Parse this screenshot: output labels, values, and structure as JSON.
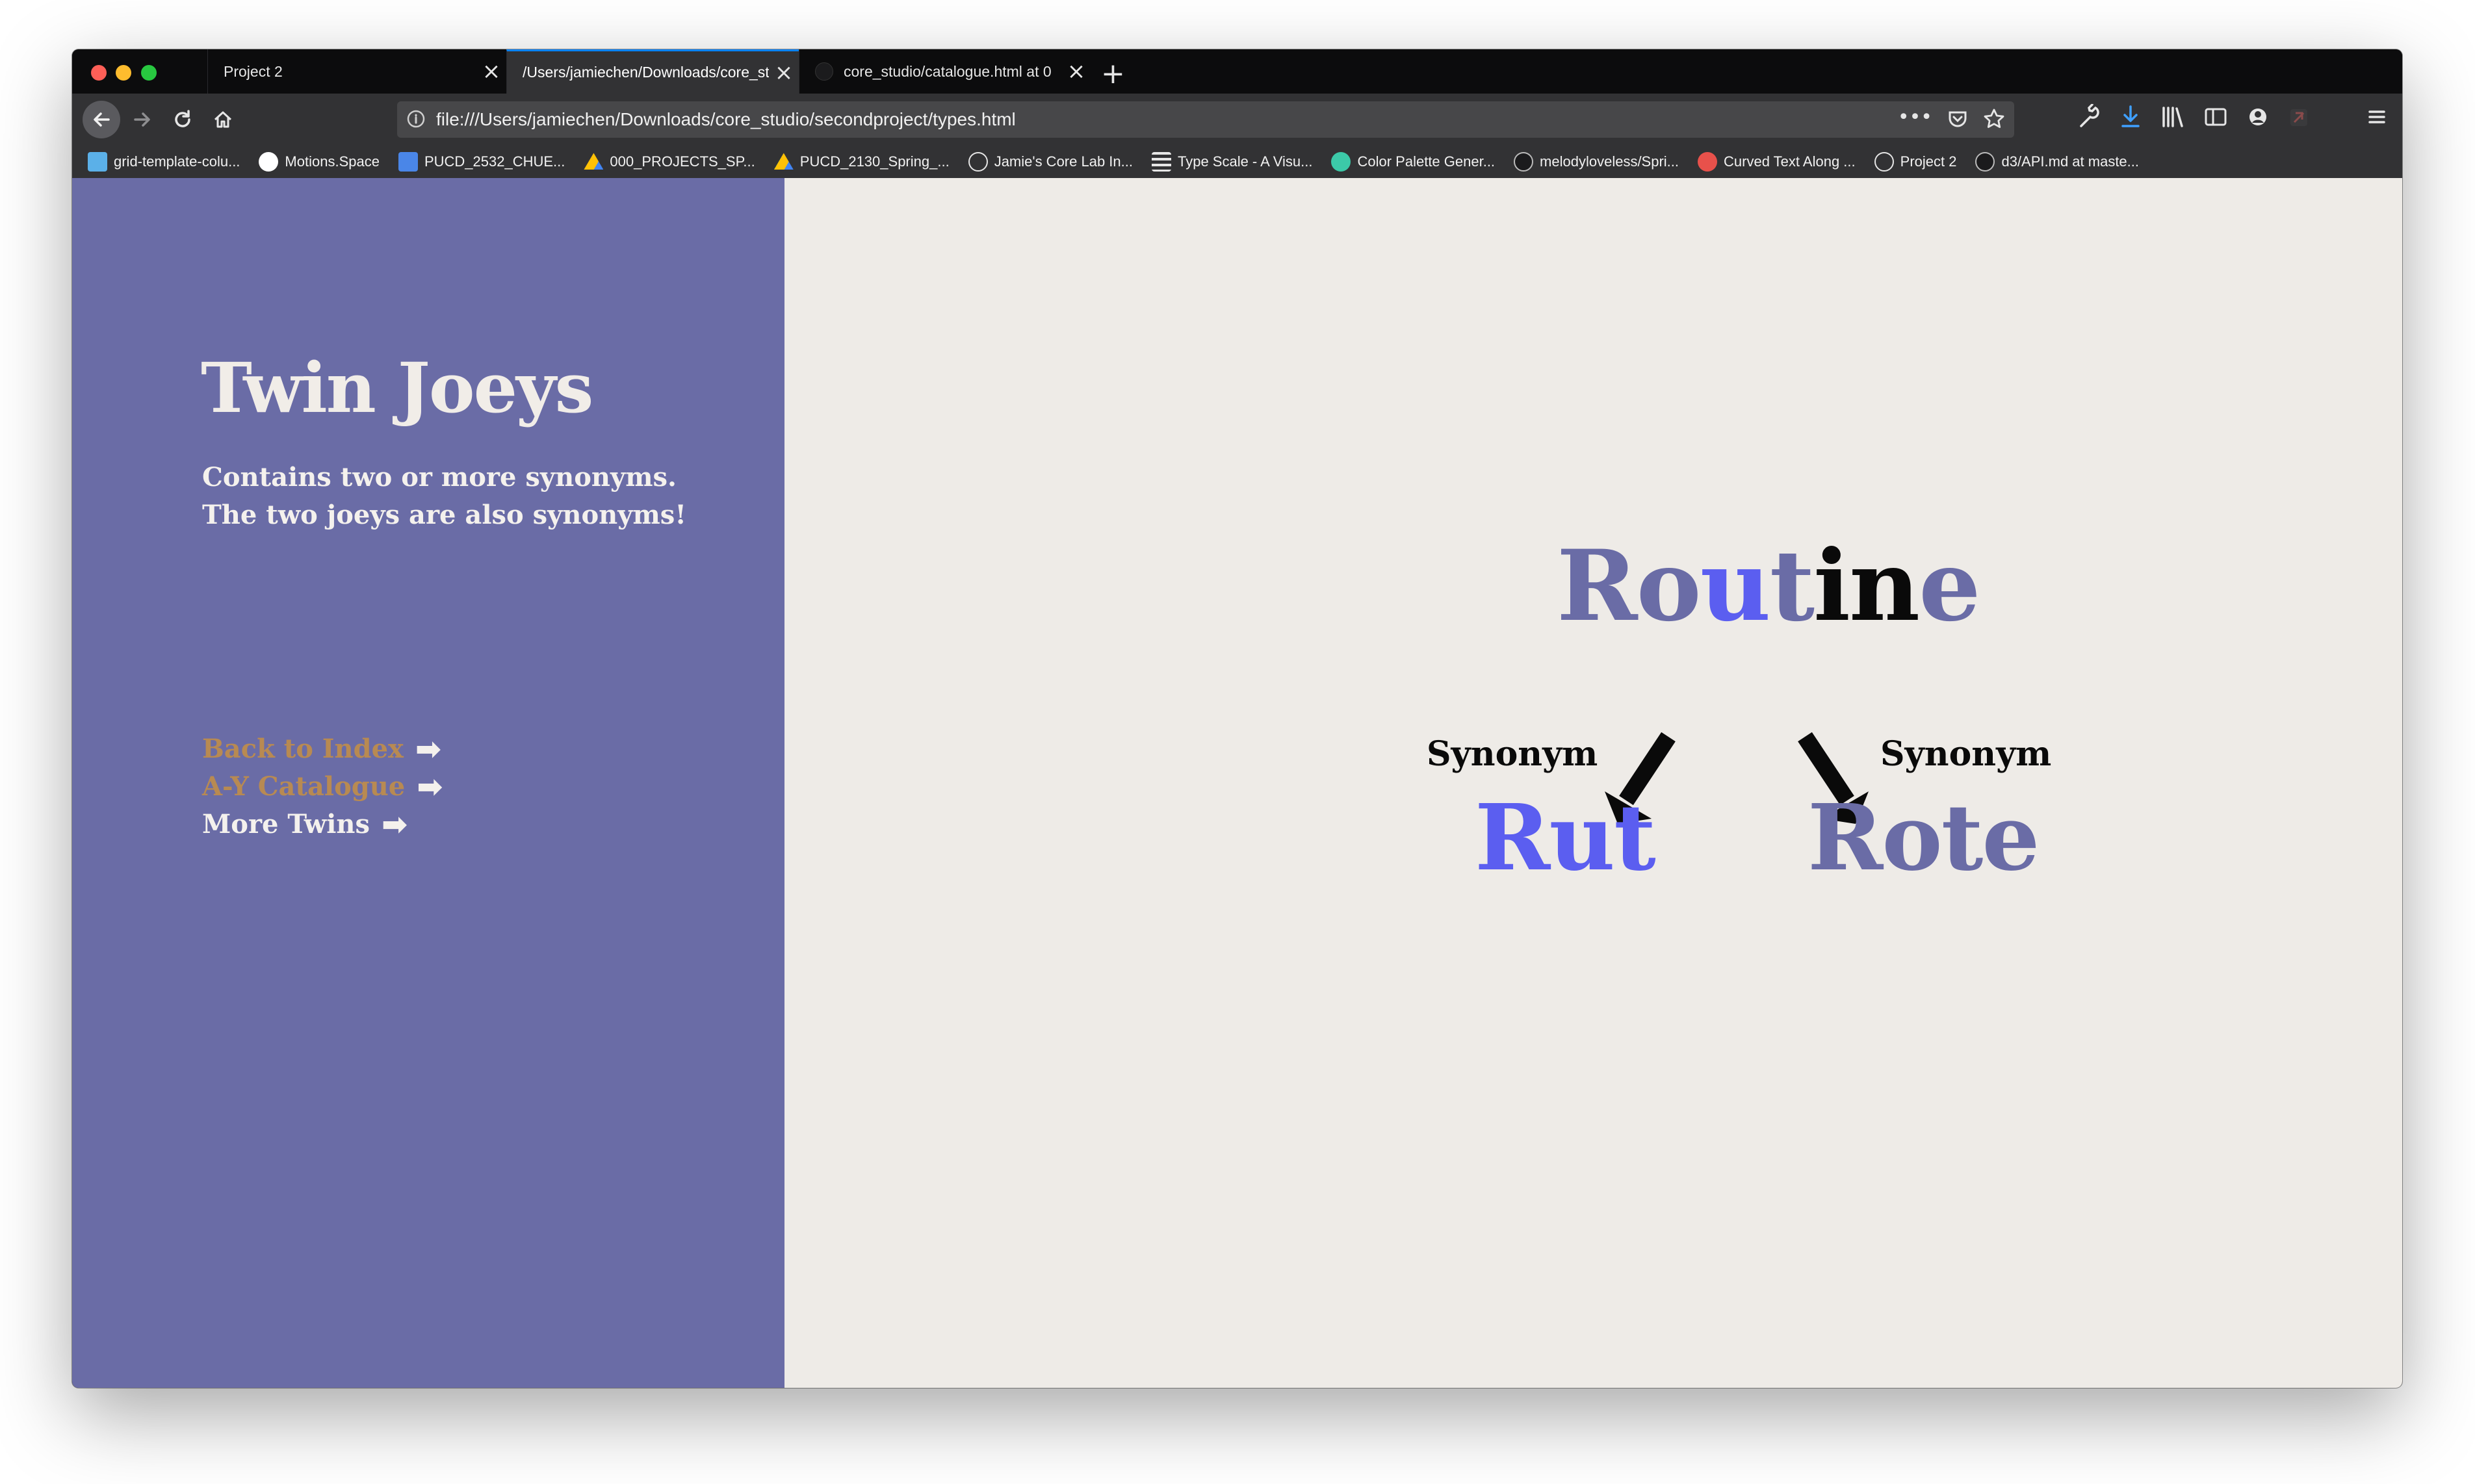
{
  "browser": {
    "tabs": [
      {
        "label": "Project 2",
        "active": false
      },
      {
        "label": "/Users/jamiechen/Downloads/core_studio/secondproject/types.html",
        "active": true
      },
      {
        "label": "core_studio/catalogue.html at 0",
        "active": false
      }
    ],
    "url": "file:///Users/jamiechen/Downloads/core_studio/secondproject/types.html",
    "bookmarks": [
      {
        "label": "grid-template-colu...",
        "icon": "grid-favicon"
      },
      {
        "label": "Motions.Space",
        "icon": "circle-favicon"
      },
      {
        "label": "PUCD_2532_CHUE...",
        "icon": "docs-favicon"
      },
      {
        "label": "000_PROJECTS_SP...",
        "icon": "drive-favicon"
      },
      {
        "label": "PUCD_2130_Spring_...",
        "icon": "drive-favicon"
      },
      {
        "label": "Jamie's Core Lab In...",
        "icon": "globe-favicon"
      },
      {
        "label": "Type Scale - A Visu...",
        "icon": "typescale-favicon"
      },
      {
        "label": "Color Palette Gener...",
        "icon": "palette-favicon"
      },
      {
        "label": "melodyloveless/Spri...",
        "icon": "github-favicon"
      },
      {
        "label": "Curved Text Along ...",
        "icon": "codepen-favicon"
      },
      {
        "label": "Project 2",
        "icon": "globe-favicon"
      },
      {
        "label": "d3/API.md at maste...",
        "icon": "github-favicon"
      }
    ]
  },
  "sidebar": {
    "title": "Twin Joeys",
    "description_line1": "Contains two or more synonyms.",
    "description_line2": "The two joeys are also synonyms!",
    "links": [
      {
        "label": "Back to Index",
        "arrow": "➡"
      },
      {
        "label": "A-Y Catalogue",
        "arrow": "➡"
      },
      {
        "label": "More Twins",
        "arrow": "➡"
      }
    ]
  },
  "main": {
    "word_parts": [
      "Ro",
      "u",
      "t",
      "in",
      "e"
    ],
    "left_label": "Synonym",
    "right_label": "Synonym",
    "left_result": "Rut",
    "right_result": "Rote"
  },
  "colors": {
    "sidebar_bg": "#6a6ca6",
    "content_bg": "#eeebe7",
    "accent_blue": "#5b5ef0",
    "muted_purple": "#6a6ca6",
    "link_tan": "#b88a52"
  }
}
